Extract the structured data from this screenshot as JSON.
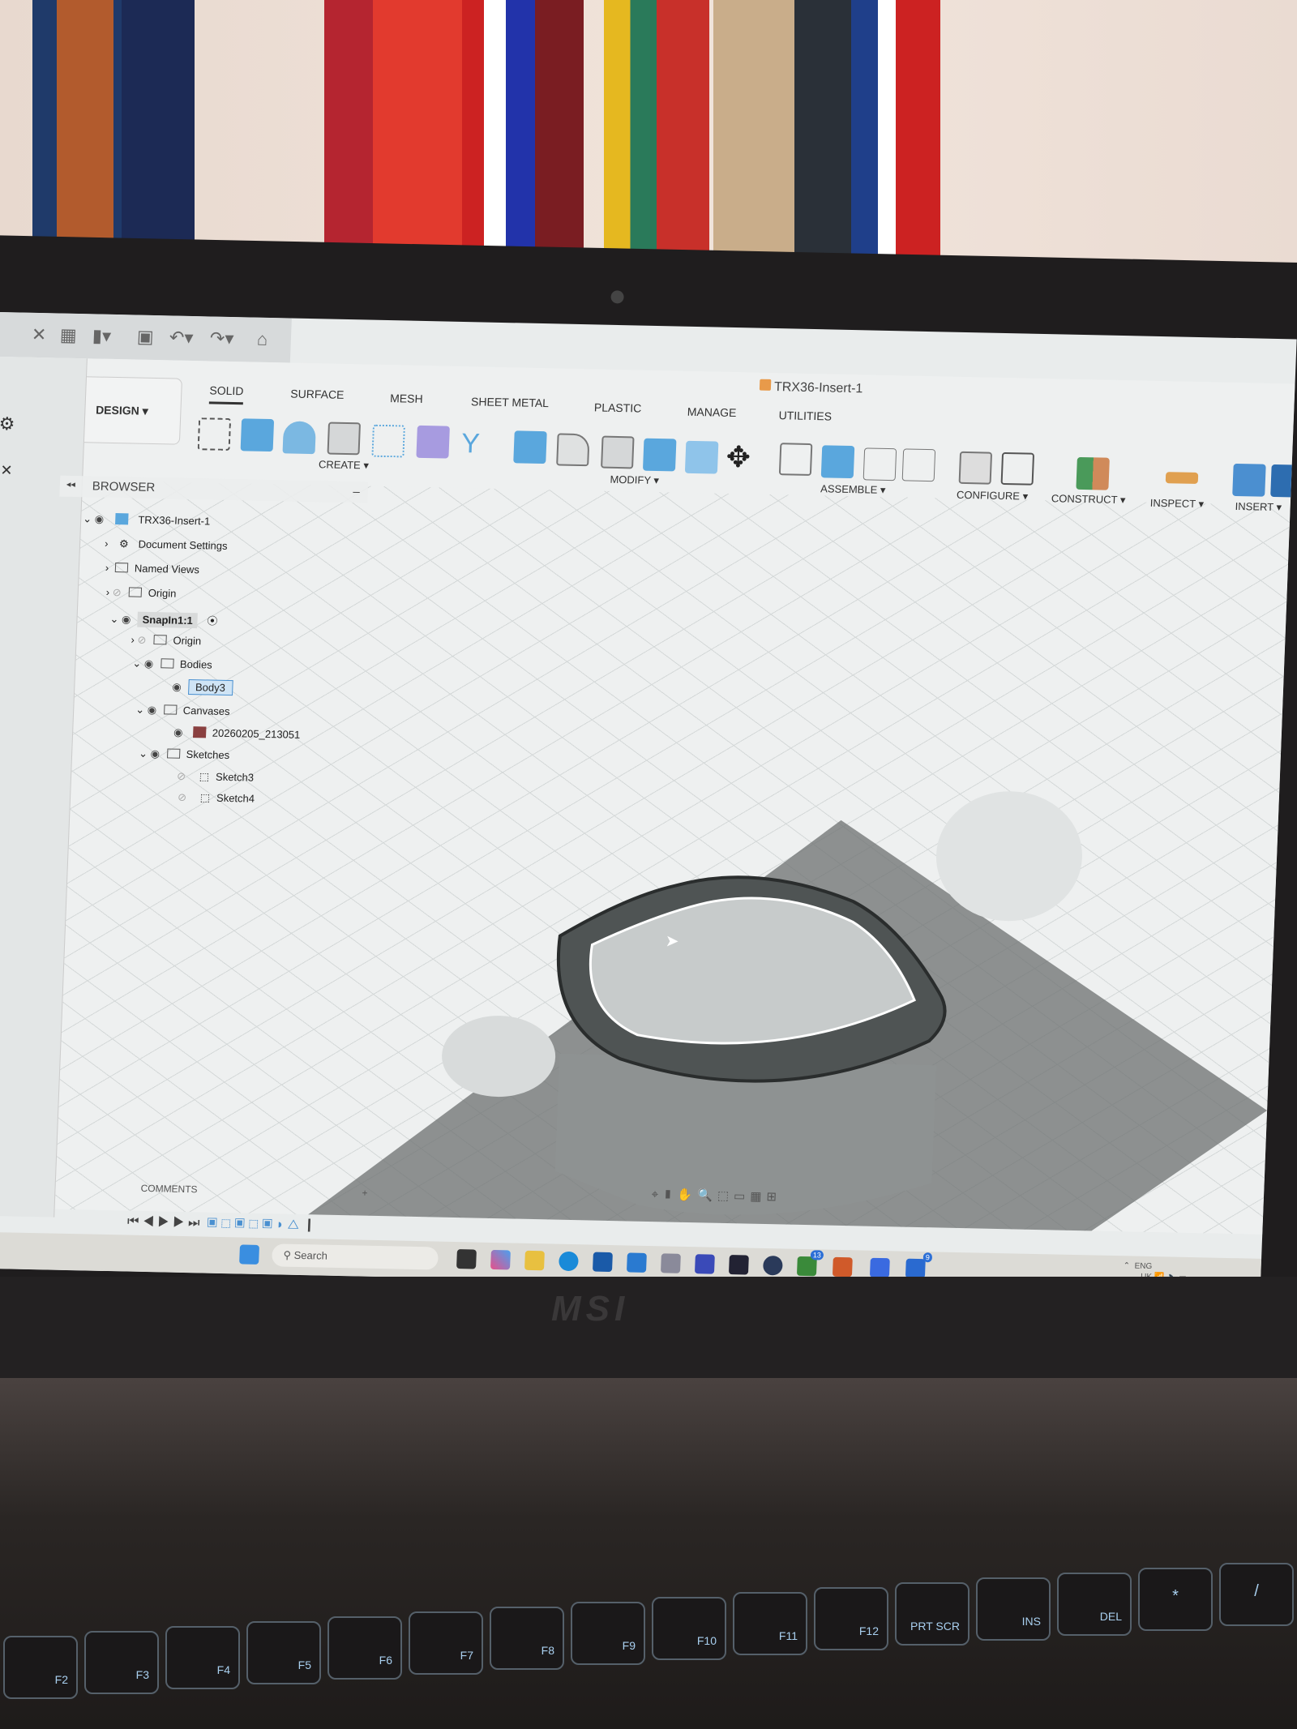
{
  "app": {
    "document_title": "TRX36-Insert-1",
    "workspace": "DESIGN"
  },
  "ribbon": {
    "tabs": [
      "SOLID",
      "SURFACE",
      "MESH",
      "SHEET METAL",
      "PLASTIC",
      "MANAGE",
      "UTILITIES"
    ],
    "groups": [
      "CREATE",
      "MODIFY",
      "ASSEMBLE",
      "CONFIGURE",
      "CONSTRUCT",
      "INSPECT",
      "INSERT"
    ]
  },
  "browser": {
    "title": "BROWSER",
    "items": [
      {
        "label": "TRX36-Insert-1"
      },
      {
        "label": "Document Settings"
      },
      {
        "label": "Named Views"
      },
      {
        "label": "Origin"
      },
      {
        "label": "SnapIn1:1"
      },
      {
        "label": "Origin"
      },
      {
        "label": "Bodies"
      },
      {
        "label": "Body3"
      },
      {
        "label": "Canvases"
      },
      {
        "label": "20260205_213051"
      },
      {
        "label": "Sketches"
      },
      {
        "label": "Sketch3"
      },
      {
        "label": "Sketch4"
      }
    ]
  },
  "comments": {
    "label": "COMMENTS"
  },
  "taskbar": {
    "search_placeholder": "Search",
    "badges": {
      "xbox": "13",
      "app": "9"
    },
    "tray_lang": "ENG",
    "tray_region": "UK"
  },
  "laptop": {
    "brand": "MSI"
  },
  "keyboard": {
    "keys": [
      "F2",
      "F3",
      "F4",
      "F5",
      "F6",
      "F7",
      "F8",
      "F9",
      "F10",
      "F11",
      "F12",
      "PRT SCR",
      "INS",
      "DEL",
      "*",
      "/"
    ]
  },
  "colors": {
    "accent": "#4a90d0",
    "ribbon_bg": "#eef0f0",
    "keyboard_backlight": "#a9d0f0"
  }
}
